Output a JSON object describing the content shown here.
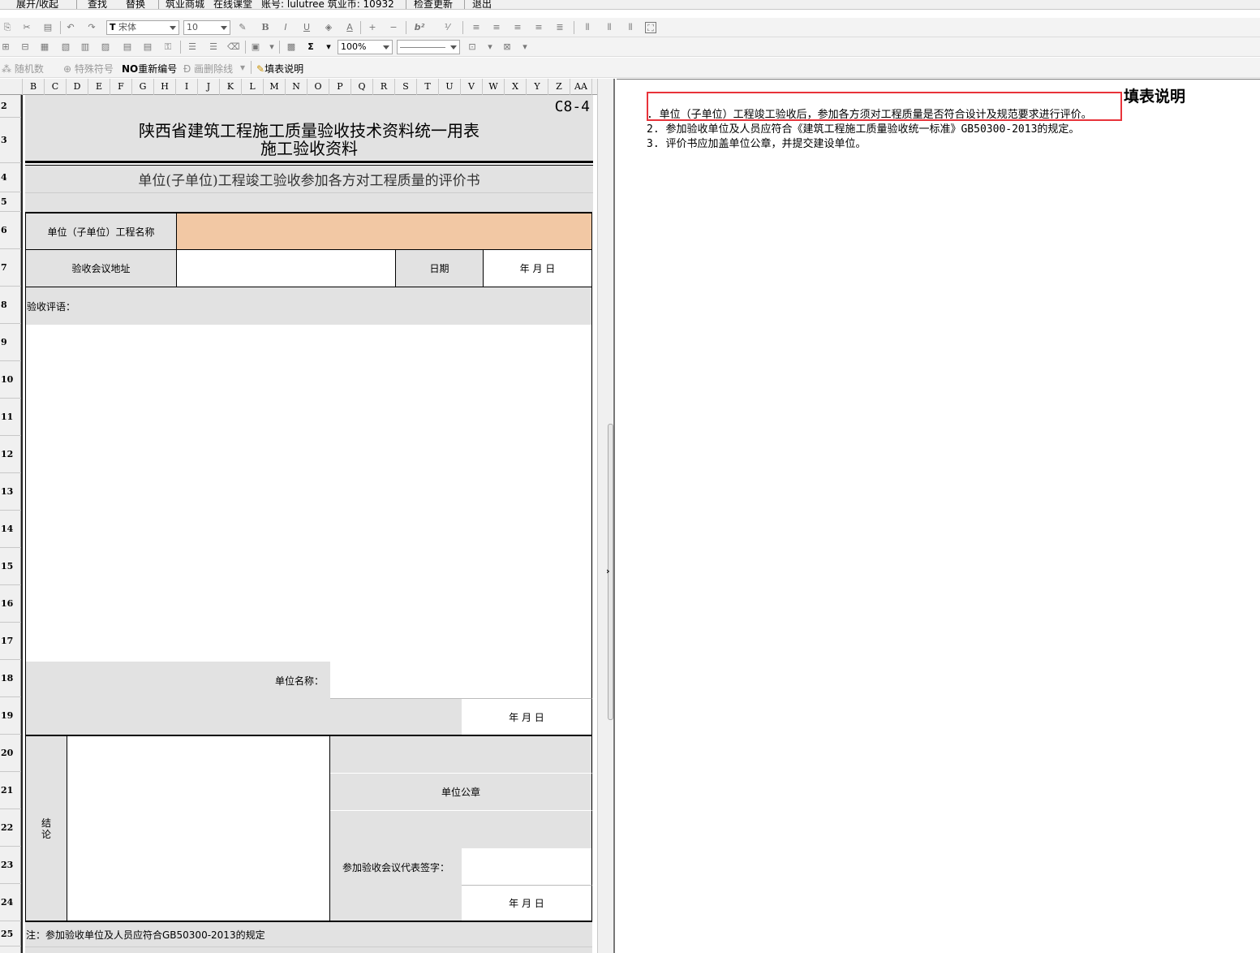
{
  "menu": {
    "items": [
      "展开/收起",
      "查找",
      "替换",
      "筑业商城",
      "在线课堂",
      "账号: lulutree 筑业币: 10932",
      "检查更新",
      "退出"
    ]
  },
  "toolbar": {
    "font_name": "宋体",
    "font_size": "10",
    "zoom": "100%",
    "sum_symbol": "Σ"
  },
  "toolbar3": {
    "random_label": "随机数",
    "special_label": "特殊符号",
    "renumber_prefix": "NO",
    "renumber_label": "重新编号",
    "strike_label": "画删除线",
    "fill_label": "填表说明"
  },
  "columns": [
    "B",
    "C",
    "D",
    "E",
    "F",
    "G",
    "H",
    "I",
    "J",
    "K",
    "L",
    "M",
    "N",
    "O",
    "P",
    "Q",
    "R",
    "S",
    "T",
    "U",
    "V",
    "W",
    "X",
    "Y",
    "Z",
    "AA"
  ],
  "rows": [
    "2",
    "3",
    "4",
    "5",
    "6",
    "7",
    "8",
    "9",
    "10",
    "11",
    "12",
    "13",
    "14",
    "15",
    "16",
    "17",
    "18",
    "19",
    "20",
    "21",
    "22",
    "23",
    "24",
    "25"
  ],
  "form": {
    "code": "C8-4",
    "title1": "陕西省建筑工程施工质量验收技术资料统一用表",
    "title2": "施工验收资料",
    "subtitle": "单位(子单位)工程竣工验收参加各方对工程质量的评价书",
    "project_name_label": "单位（子单位）工程名称",
    "meeting_addr_label": "验收会议地址",
    "date_label": "日期",
    "date_value": "年  月  日",
    "comments_label": "验收评语：",
    "unit_name_label": "单位名称：",
    "date_value2": "年  月  日",
    "conclusion_label": "结论",
    "seal_label": "单位公章",
    "rep_sign_label": "参加验收会议代表签字：",
    "date_value3": "年  月  日",
    "note": "注：参加验收单位及人员应符合GB50300-2013的规定"
  },
  "notes": {
    "title": "填表说明",
    "lines": [
      ". 单位（子单位）工程竣工验收后，参加各方须对工程质量是否符合设计及规范要求进行评价。",
      "2. 参加验收单位及人员应符合《建筑工程施工质量验收统一标准》GB50300-2013的规定。",
      "3. 评价书应加盖单位公章，并提交建设单位。"
    ]
  }
}
